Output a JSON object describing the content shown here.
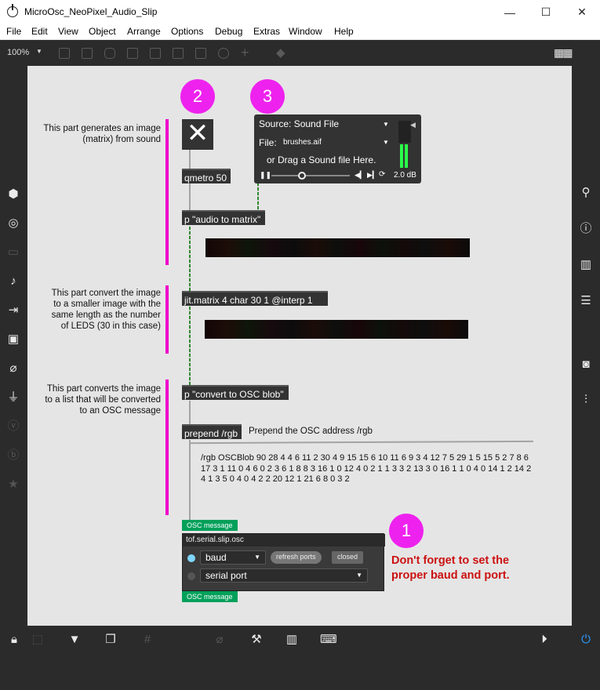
{
  "window": {
    "title": "MicroOsc_NeoPixel_Audio_Slip",
    "controls": [
      "—",
      "☐",
      "✕"
    ]
  },
  "menubar": [
    "File",
    "Edit",
    "View",
    "Object",
    "Arrange",
    "Options",
    "Debug",
    "Extras",
    "Window",
    "Help"
  ],
  "toolbar": {
    "zoom": "100%"
  },
  "badges": [
    "2",
    "3",
    "1"
  ],
  "comments": {
    "generate": "This part generates an image (matrix) from sound",
    "convert": "This part convert the image to a smaller image with the same length as the number of LEDS (30 in this case)",
    "osc": "This part converts the image to a list that will be converted to an OSC message",
    "prepend_note": "Prepend the OSC address /rgb",
    "warning": "Don't forget to set the proper baud and port."
  },
  "objects": {
    "qmetro": "qmetro 50",
    "audio_to_matrix": "p \"audio to matrix\"",
    "jit_matrix": "jit.matrix 4 char 30 1 @interp 1",
    "convert_blob": "p \"convert to OSC blob\"",
    "prepend": "prepend /rgb"
  },
  "sfplayer": {
    "source": "Source: Sound File",
    "file_label": "File:",
    "file_name": "brushes.aif",
    "drag_hint": "or Drag a Sound file Here.",
    "gain": "2.0 dB"
  },
  "blob_text": "/rgb OSCBlob 90 28 4 4 6 11 2 30 4 9 15 15 6 10 11 6 9 3 4 12 7 5 29 1 5 15 5 2 7 8 6 17 3 1 11 0 4 6 0 2 3 6 1 8 8 3 16 1 0 12 4 0 2 1 1 3 3 2 13 3 0 16 1 1 0 4 0 14 1 2 14 2 4 1 3 5 0 4 0 4 2 2 20 12 1 21 6 8 0 3 2",
  "osc_message_label": "OSC message",
  "serial": {
    "title": "tof.serial.slip.osc",
    "baud": "baud",
    "refresh": "refresh ports",
    "status": "closed",
    "port": "serial port"
  },
  "colors": {
    "accent_magenta": "#ee22ee",
    "warning_red": "#cc1111",
    "osc_green": "#00a05a",
    "meter_green": "#2aff4a"
  }
}
